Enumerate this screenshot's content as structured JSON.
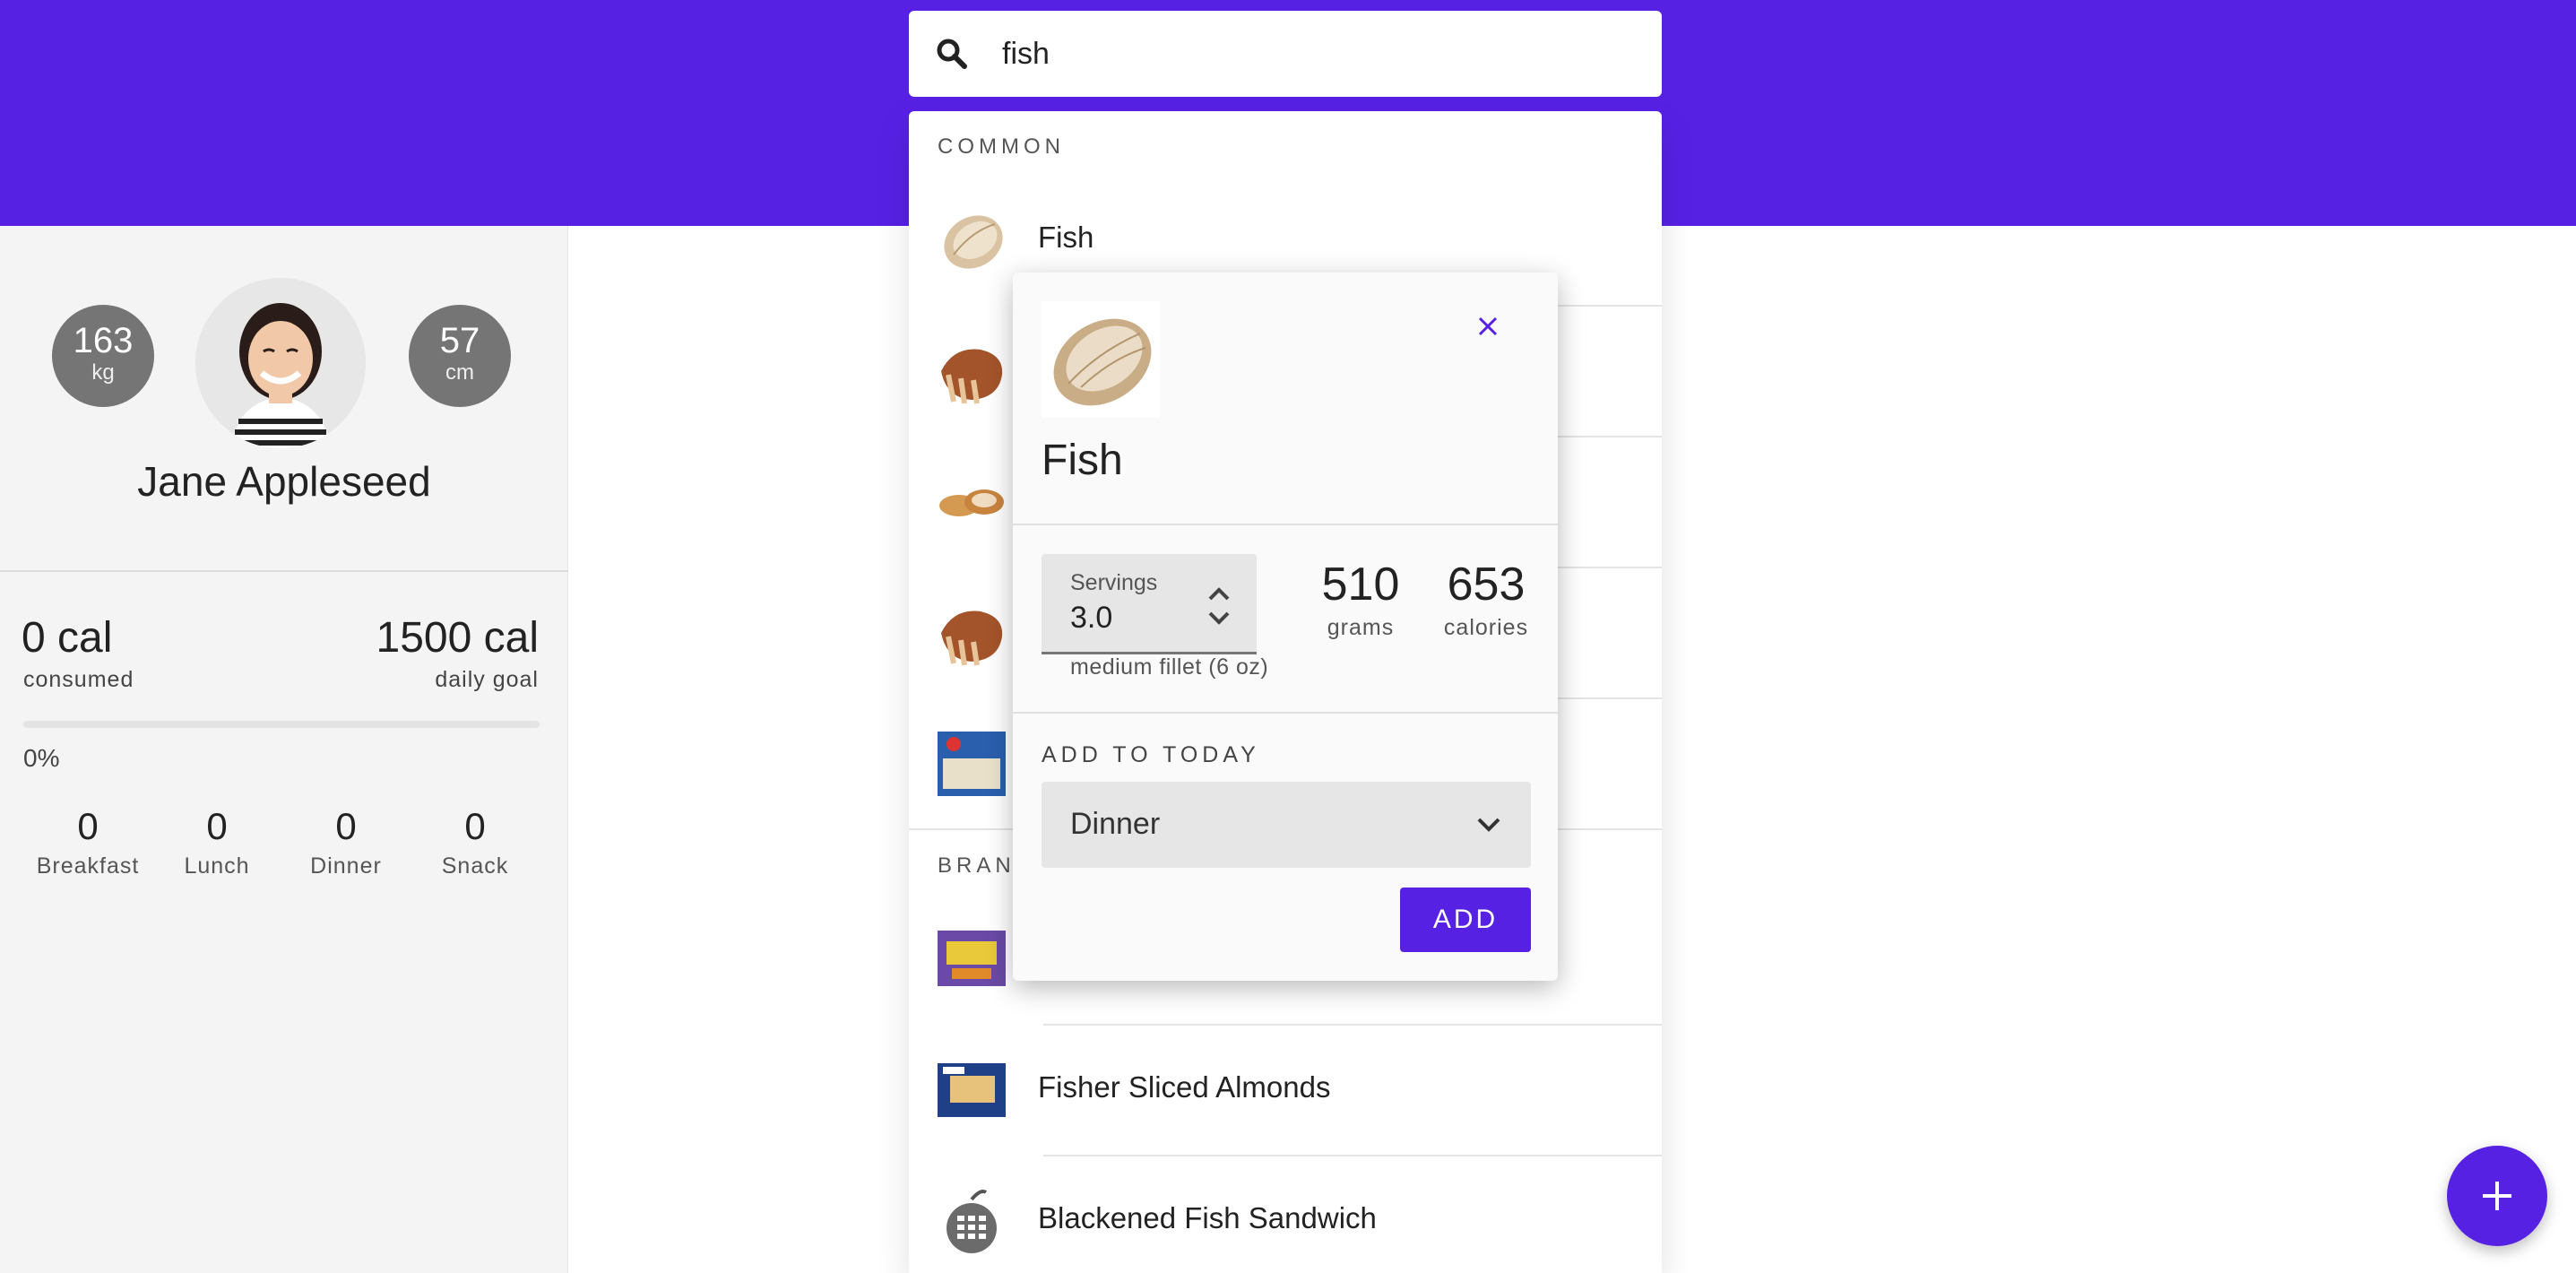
{
  "search": {
    "value": "fish"
  },
  "profile": {
    "weight_value": "163",
    "weight_unit": "kg",
    "height_value": "57",
    "height_unit": "cm",
    "name": "Jane Appleseed"
  },
  "calories": {
    "consumed_value": "0 cal",
    "consumed_label": "consumed",
    "goal_value": "1500 cal",
    "goal_label": "daily goal",
    "percent_text": "0%",
    "percent": 0
  },
  "meals": [
    {
      "value": "0",
      "label": "Breakfast"
    },
    {
      "value": "0",
      "label": "Lunch"
    },
    {
      "value": "0",
      "label": "Dinner"
    },
    {
      "value": "0",
      "label": "Snack"
    }
  ],
  "results": {
    "common_header": "COMMON",
    "branded_header": "BRAN",
    "common_items": [
      {
        "name": "Fish",
        "icon": "fish-fillet-icon"
      },
      {
        "name": "",
        "icon": "fried-fish-icon"
      },
      {
        "name": "",
        "icon": "fish-pieces-icon"
      },
      {
        "name": "",
        "icon": "fried-fish-icon"
      },
      {
        "name": "",
        "icon": "fish-package-icon"
      }
    ],
    "branded_items": [
      {
        "name": "",
        "icon": "snack-package-icon"
      },
      {
        "name": "Fisher Sliced Almonds",
        "icon": "almond-package-icon"
      },
      {
        "name": "Blackened Fish Sandwich",
        "icon": "apple-calculator-icon"
      }
    ]
  },
  "popup": {
    "title": "Fish",
    "servings_label": "Servings",
    "servings_value": "3.0",
    "serving_hint": "medium fillet (6 oz)",
    "grams_value": "510",
    "grams_label": "grams",
    "calories_value": "653",
    "calories_label": "calories",
    "add_header": "ADD TO TODAY",
    "meal_selected": "Dinner",
    "add_label": "ADD"
  },
  "colors": {
    "accent": "#5721e4",
    "stat_circle": "#757575",
    "sidebar_bg": "#f4f4f4"
  }
}
